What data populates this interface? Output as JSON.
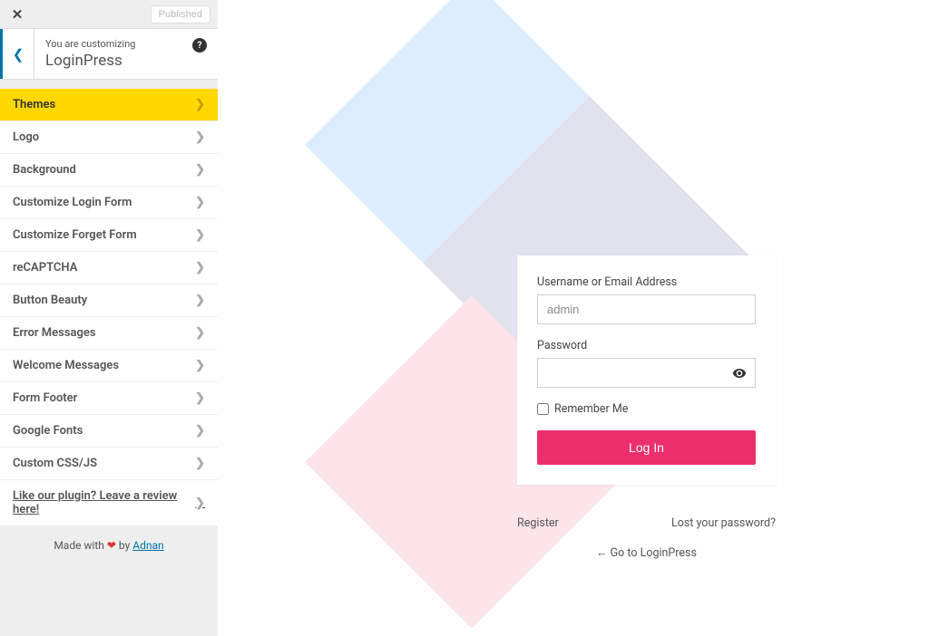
{
  "header": {
    "published": "Published",
    "customizing": "You are customizing",
    "title": "LoginPress"
  },
  "menu": [
    {
      "label": "Themes",
      "active": true
    },
    {
      "label": "Logo"
    },
    {
      "label": "Background"
    },
    {
      "label": "Customize Login Form"
    },
    {
      "label": "Customize Forget Form"
    },
    {
      "label": "reCAPTCHA"
    },
    {
      "label": "Button Beauty"
    },
    {
      "label": "Error Messages"
    },
    {
      "label": "Welcome Messages"
    },
    {
      "label": "Form Footer"
    },
    {
      "label": "Google Fonts"
    },
    {
      "label": "Custom CSS/JS"
    },
    {
      "label": "Like our plugin? Leave a review here!",
      "review": true
    }
  ],
  "footer": {
    "prefix": "Made with ",
    "heart": "❤",
    "by": " by ",
    "author": "Adnan"
  },
  "login": {
    "username_label": "Username or Email Address",
    "username_value": "admin",
    "password_label": "Password",
    "remember": "Remember Me",
    "button": "Log In",
    "register": "Register",
    "lost": "Lost your password?",
    "goback": "← Go to LoginPress"
  }
}
